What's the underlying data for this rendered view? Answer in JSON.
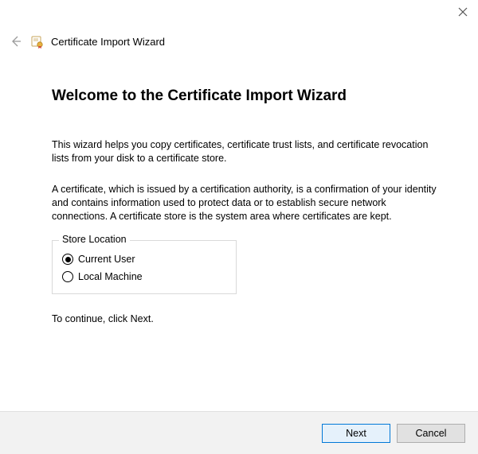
{
  "window": {
    "title": "Certificate Import Wizard"
  },
  "page": {
    "welcome_heading": "Welcome to the Certificate Import Wizard",
    "paragraph1": "This wizard helps you copy certificates, certificate trust lists, and certificate revocation lists from your disk to a certificate store.",
    "paragraph2": "A certificate, which is issued by a certification authority, is a confirmation of your identity and contains information used to protect data or to establish secure network connections. A certificate store is the system area where certificates are kept.",
    "store_location": {
      "legend": "Store Location",
      "options": [
        {
          "label": "Current User",
          "selected": true
        },
        {
          "label": "Local Machine",
          "selected": false
        }
      ]
    },
    "continue_hint": "To continue, click Next."
  },
  "buttons": {
    "next": "Next",
    "cancel": "Cancel"
  }
}
